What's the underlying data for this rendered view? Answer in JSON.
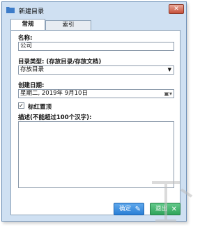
{
  "window": {
    "title": "新建目录"
  },
  "tabs": [
    {
      "label": "常规"
    },
    {
      "label": "索引"
    }
  ],
  "form": {
    "name_label": "名称:",
    "name_value": "公司",
    "type_label": "目录类型: (存放目录/存放文档)",
    "type_value": "存放目录",
    "date_label": "创建日期:",
    "date_value": "星期二, 2019年 9月10日",
    "red_label": "标红置顶",
    "red_checked": true,
    "desc_label": "描述(不能超过100个汉字):",
    "desc_value": ""
  },
  "buttons": {
    "ok_label": "确定",
    "exit_label": "退出"
  },
  "icons": {
    "title": "folder-icon",
    "close": "close-icon",
    "dropdown": "chevron-down-icon",
    "calendar": "calendar-icon",
    "ok": "pen-icon",
    "exit": "exit-icon"
  },
  "colors": {
    "ok_button": "#2b7fd6",
    "exit_button": "#2fa45b",
    "close_button": "#c7503a"
  }
}
